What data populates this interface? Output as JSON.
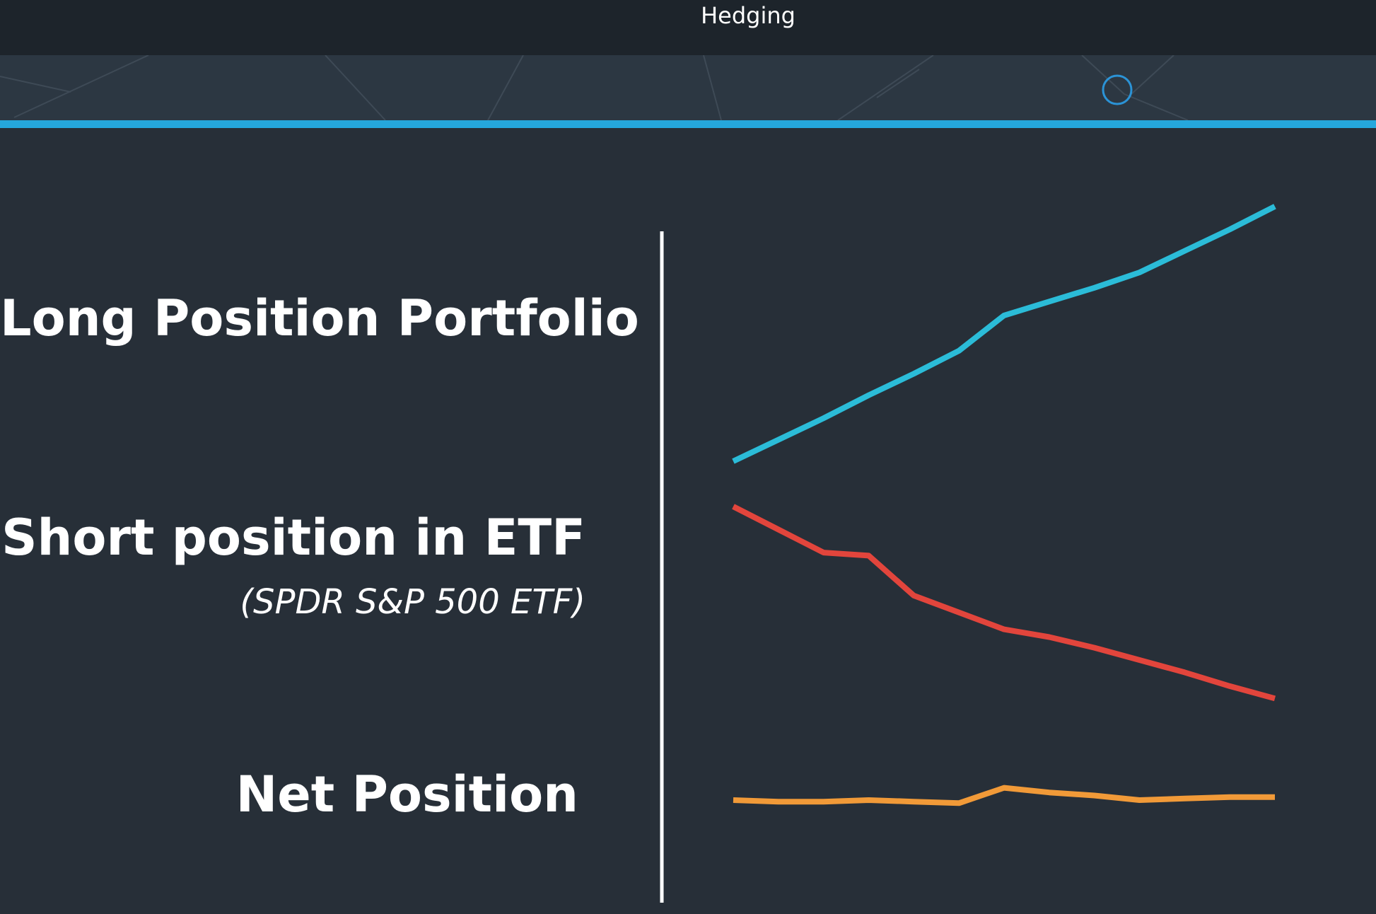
{
  "window": {
    "title": "Hedging"
  },
  "theme": {
    "background": "#272f38",
    "titlebar": "#1d242b",
    "header_band": "#2c3742",
    "accent": "#25a7dc",
    "divider": "#ffffff",
    "text": "#ffffff"
  },
  "header": {
    "icon": "circle-outline-icon"
  },
  "chart_data": {
    "type": "line",
    "title": "",
    "xlabel": "",
    "ylabel": "",
    "grid": false,
    "x": [
      0,
      1,
      2,
      3,
      4,
      5,
      6,
      7,
      8,
      9,
      10,
      11,
      12
    ],
    "series": [
      {
        "name": "Long Position Portfolio",
        "color": "#2bbcd8",
        "values": [
          0,
          14,
          28,
          43,
          57,
          72,
          95,
          104,
          113,
          123,
          137,
          151,
          166
        ]
      },
      {
        "name": "Short position in ETF",
        "subtitle": "(SPDR S&P 500 ETF)",
        "color": "#e2453c",
        "values": [
          0,
          -15,
          -30,
          -32,
          -58,
          -69,
          -80,
          -85,
          -92,
          -100,
          -108,
          -117,
          -125
        ]
      },
      {
        "name": "Net Position",
        "color": "#f19a38",
        "values": [
          0,
          -1,
          -1,
          0,
          -1,
          -2,
          8,
          5,
          3,
          0,
          1,
          2,
          2
        ]
      }
    ]
  }
}
